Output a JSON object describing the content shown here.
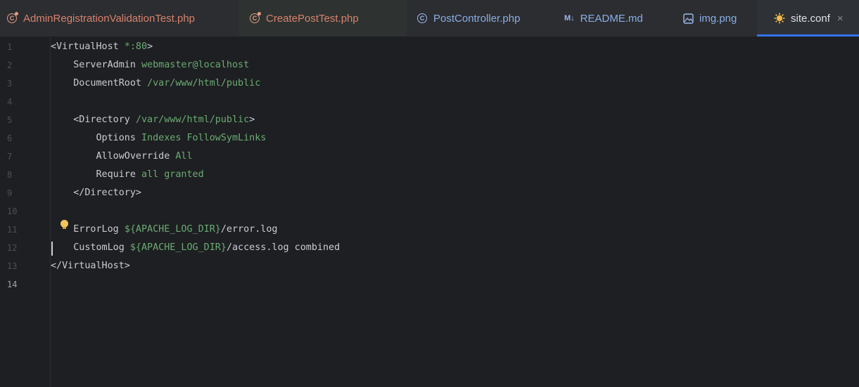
{
  "tabs": [
    {
      "label": "AdminRegistrationValidationTest.php",
      "icon": "php-class-icon",
      "color": "#d9826e"
    },
    {
      "label": "CreatePostTest.php",
      "icon": "php-class-icon",
      "color": "#d9826e"
    },
    {
      "label": "PostController.php",
      "icon": "php-class-icon",
      "color": "#8aaee6"
    },
    {
      "label": "README.md",
      "icon": "markdown-icon",
      "icon_text": "M↓",
      "color": "#8aaee6"
    },
    {
      "label": "img.png",
      "icon": "image-icon",
      "color": "#8aaee6"
    },
    {
      "label": "site.conf",
      "icon": "config-icon",
      "color": "#dfe1e5",
      "active": true,
      "close": "×"
    }
  ],
  "editor": {
    "current_line": 14,
    "line_numbers": [
      "1",
      "2",
      "3",
      "4",
      "5",
      "6",
      "7",
      "8",
      "9",
      "10",
      "11",
      "12",
      "13",
      "14"
    ],
    "lines": [
      {
        "key": "<VirtualHost ",
        "val": "*:80",
        "tail": ">"
      },
      {
        "key": "    ServerAdmin ",
        "val": "webmaster@localhost",
        "tail": ""
      },
      {
        "key": "    DocumentRoot ",
        "val": "/var/www/html/public",
        "tail": ""
      },
      {
        "key": "",
        "val": "",
        "tail": ""
      },
      {
        "key": "    <Directory ",
        "val": "/var/www/html/public",
        "tail": ">"
      },
      {
        "key": "        Options ",
        "val": "Indexes FollowSymLinks",
        "tail": ""
      },
      {
        "key": "        AllowOverride ",
        "val": "All",
        "tail": ""
      },
      {
        "key": "        Require ",
        "val": "all granted",
        "tail": ""
      },
      {
        "key": "    </Directory>",
        "val": "",
        "tail": ""
      },
      {
        "key": "",
        "val": "",
        "tail": ""
      },
      {
        "key": "    ErrorLog ",
        "val": "${APACHE_LOG_DIR}",
        "tail": "/error.log"
      },
      {
        "key": "    CustomLog ",
        "val": "${APACHE_LOG_DIR}",
        "tail": "/access.log combined"
      },
      {
        "key": "</VirtualHost>",
        "val": "",
        "tail": ""
      },
      {
        "key": "",
        "val": "",
        "tail": ""
      }
    ]
  },
  "colors": {
    "background": "#1e1f22",
    "tabbar": "#2b2d30",
    "keyword": "#c9ccd3",
    "value": "#6aab73",
    "accent": "#3574f0"
  }
}
